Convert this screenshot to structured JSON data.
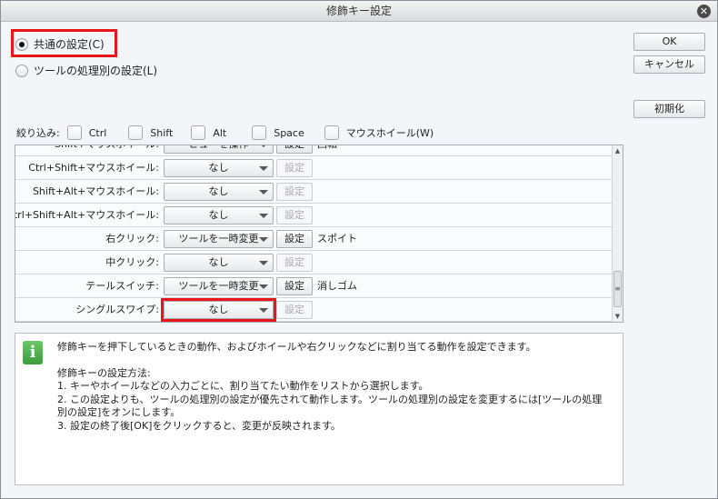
{
  "window": {
    "title": "修飾キー設定"
  },
  "mode": {
    "common_label": "共通の設定(C)",
    "per_tool_label": "ツールの処理別の設定(L)",
    "selected": "common"
  },
  "buttons": {
    "ok": "OK",
    "cancel": "キャンセル",
    "reset": "初期化"
  },
  "filter": {
    "label": "絞り込み:",
    "options": [
      "Ctrl",
      "Shift",
      "Alt",
      "Space",
      "マウスホイール(W)"
    ]
  },
  "rows": [
    {
      "label": "Shift+マウスホイール:",
      "value": "ビューを操作",
      "set": "設定",
      "enabled": true,
      "extra": "回転"
    },
    {
      "label": "Ctrl+Shift+マウスホイール:",
      "value": "なし",
      "set": "設定",
      "enabled": false,
      "extra": ""
    },
    {
      "label": "Shift+Alt+マウスホイール:",
      "value": "なし",
      "set": "設定",
      "enabled": false,
      "extra": ""
    },
    {
      "label": "Ctrl+Shift+Alt+マウスホイール:",
      "value": "なし",
      "set": "設定",
      "enabled": false,
      "extra": ""
    },
    {
      "label": "右クリック:",
      "value": "ツールを一時変更",
      "set": "設定",
      "enabled": true,
      "extra": "スポイト"
    },
    {
      "label": "中クリック:",
      "value": "なし",
      "set": "設定",
      "enabled": false,
      "extra": ""
    },
    {
      "label": "テールスイッチ:",
      "value": "ツールを一時変更",
      "set": "設定",
      "enabled": true,
      "extra": "消しゴム"
    },
    {
      "label": "シングルスワイプ:",
      "value": "なし",
      "set": "設定",
      "enabled": false,
      "extra": ""
    }
  ],
  "info": {
    "line1": "修飾キーを押下しているときの動作、およびホイールや右クリックなどに割り当てる動作を設定できます。",
    "heading": "修飾キーの設定方法:",
    "step1": "1. キーやホイールなどの入力ごとに、割り当てたい動作をリストから選択します。",
    "step2": "2. この設定よりも、ツールの処理別の設定が優先されて動作します。ツールの処理別の設定を変更するには[ツールの処理別の設定]をオンにします。",
    "step3": "3. 設定の終了後[OK]をクリックすると、変更が反映されます。"
  },
  "colors": {
    "highlight": "#e8161b",
    "info_icon": "#4caf50"
  }
}
